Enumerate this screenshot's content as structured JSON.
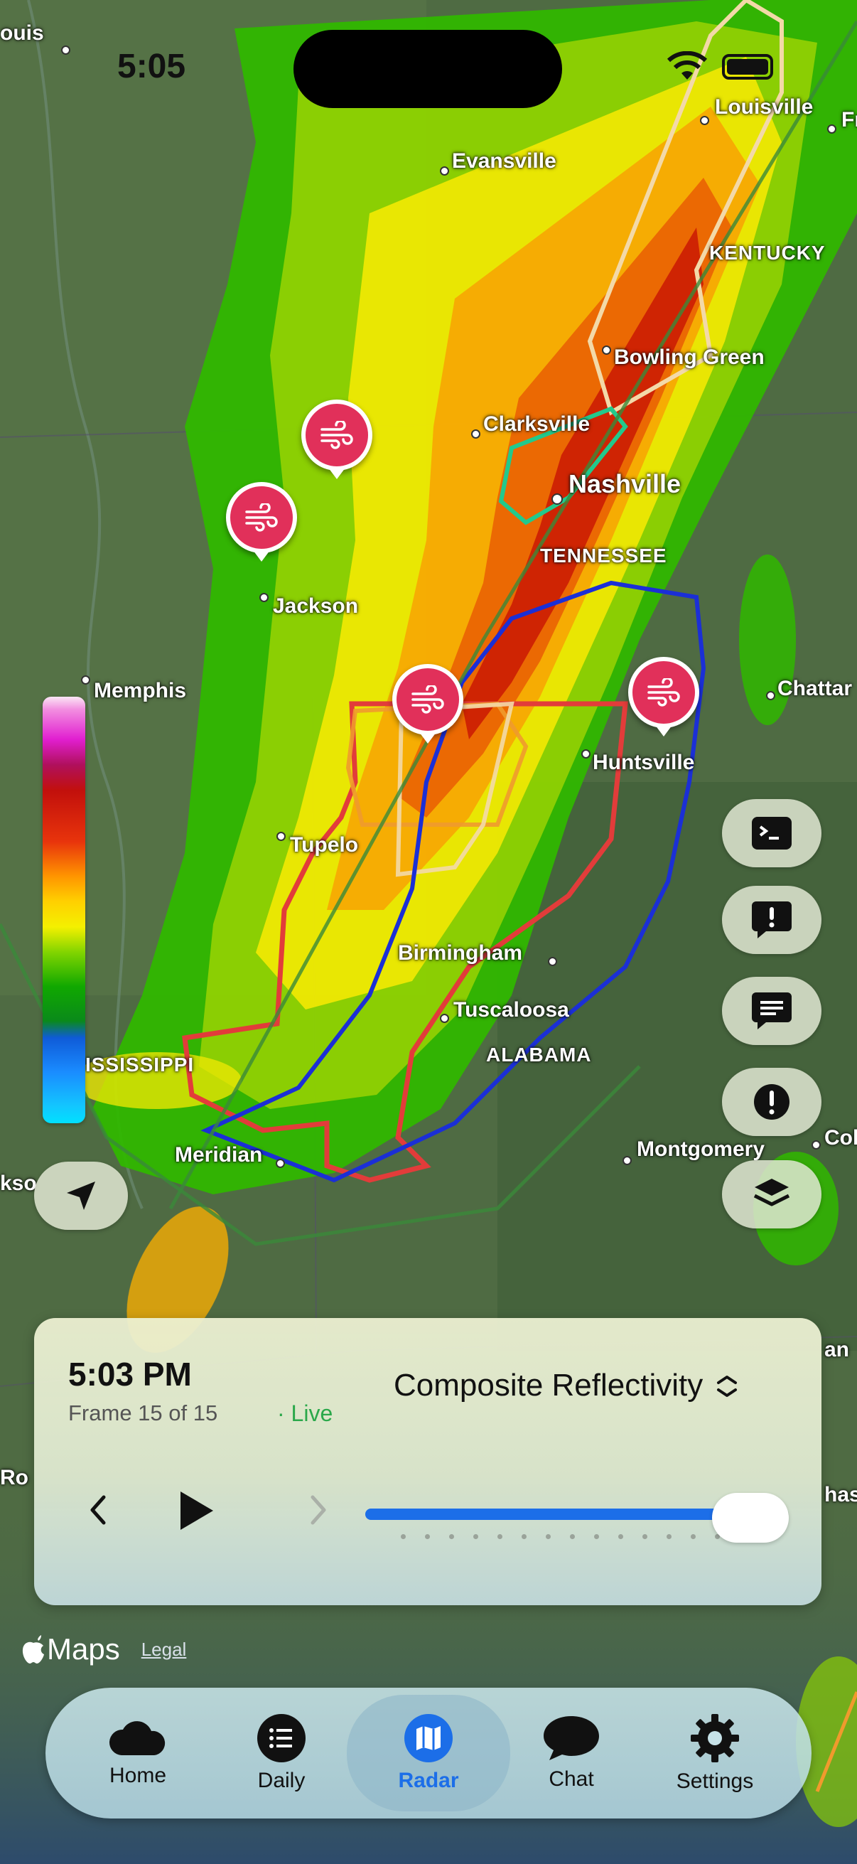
{
  "status_bar": {
    "time": "5:05"
  },
  "map": {
    "cities": [
      {
        "name": "Louisville"
      },
      {
        "name": "Evansville"
      },
      {
        "name": "Bowling Green"
      },
      {
        "name": "Clarksville"
      },
      {
        "name": "Nashville"
      },
      {
        "name": "Jackson"
      },
      {
        "name": "Memphis"
      },
      {
        "name": "Huntsville"
      },
      {
        "name": "Tupelo"
      },
      {
        "name": "Birmingham"
      },
      {
        "name": "Tuscaloosa"
      },
      {
        "name": "Meridian"
      },
      {
        "name": "Montgomery"
      }
    ],
    "partial_cities": {
      "louis": "ouis",
      "chatt": "Chattar",
      "fr": "Fr",
      "col": "Col",
      "kso": "kso",
      "ro": "Ro",
      "an": "an",
      "has": "has"
    },
    "states": {
      "kentucky": "KENTUCKY",
      "tennessee": "TENNESSEE",
      "alabama": "ALABAMA",
      "mississippi": "ISSISSIPPI"
    },
    "attribution": {
      "brand": "Maps",
      "legal": "Legal"
    }
  },
  "radar_panel": {
    "time": "5:03 PM",
    "frame": "Frame 15 of 15",
    "live": "Live",
    "product": "Composite Reflectivity",
    "progress": 1.0,
    "frame_count": 15
  },
  "tabs": [
    {
      "label": "Home",
      "icon": "cloud-icon"
    },
    {
      "label": "Daily",
      "icon": "list-icon"
    },
    {
      "label": "Radar",
      "icon": "map-icon",
      "active": true
    },
    {
      "label": "Chat",
      "icon": "chat-bubble-icon"
    },
    {
      "label": "Settings",
      "icon": "gear-icon"
    }
  ],
  "colors": {
    "accent": "#1c6ee8",
    "live": "#2aa84a",
    "pin": "#e1305a"
  }
}
